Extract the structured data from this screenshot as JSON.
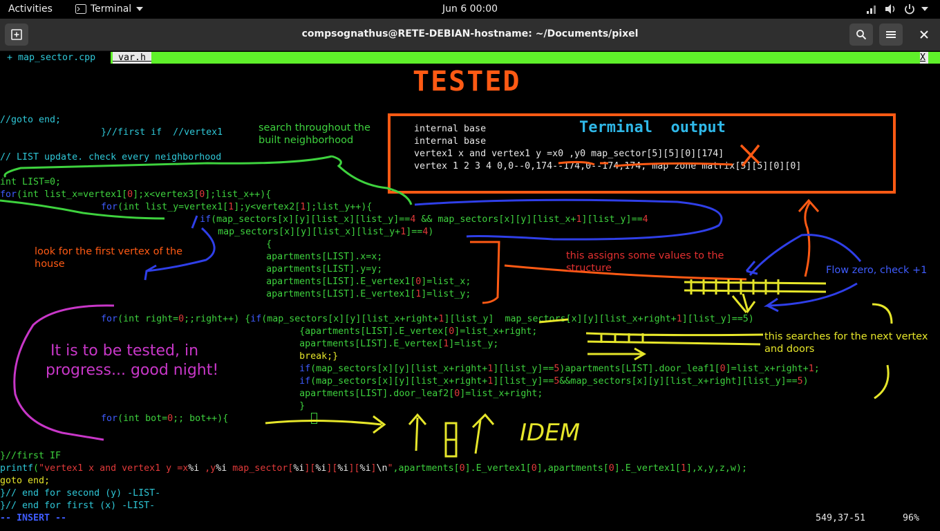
{
  "topbar": {
    "activities": "Activities",
    "app_menu": "Terminal",
    "clock": "Jun 6  00:00"
  },
  "window": {
    "title": "compsognathus@RETE-DEBIAN-hostname: ~/Documents/pixel"
  },
  "tabs": {
    "tab1": "+ map_sector.cpp ",
    "tab2": " var.h ",
    "close": "X"
  },
  "annotations": {
    "tested": "TESTED",
    "terminal_output_title": "Terminal  output",
    "search_note_1": "search throughout the",
    "search_note_2": "built neighborhood",
    "look_note_1": "look for the first vertex of the",
    "look_note_2": "house",
    "assign_note_1": "this assigns some values to the",
    "assign_note_2": "structure",
    "flow_note": "Flow zero, check +1",
    "next_note_1": "this searches for the next vertex",
    "next_note_2": "and doors",
    "progress_1": "It is  to be tested, in",
    "progress_2": "progress... good night!",
    "idem": "IDEM"
  },
  "terminal_output": {
    "line1": "internal base",
    "line2": "internal base",
    "line3": "vertex1 x and vertex1 y =x0 ,y0 map_sector[5][5][0][174]",
    "line4": "vertex 1 2 3 4 0,0--0,174--174,0--174,174, map zone matrix[5][5][0][0]"
  },
  "code": {
    "l1": "//goto end;",
    "l2": "        }//first if  //vertex1",
    "l3": "// LIST update. check every neighborhood",
    "l4": "int LIST=0;",
    "l5a": "for",
    "l5b": "(int list_x=vertex1[",
    "l5c": "0",
    "l5d": "];x<vertex3[",
    "l5e": "0",
    "l5f": "];list_x++){",
    "l6a": "        for",
    "l6b": "(int list_y=vertex1[",
    "l6c": "1",
    "l6d": "];y<vertex2[",
    "l6e": "1",
    "l6f": "];list_y++){",
    "l7a": "                if",
    "l7b": "(map_sectors[x][y][list_x][list_y]==",
    "l7c": "4",
    "l7d": " && map_sectors[x][y][list_x+",
    "l7e": "1",
    "l7f": "][list_y]==",
    "l7g": "4",
    "l8a": "                 map_sectors[x][y][list_x][list_y+",
    "l8b": "1",
    "l8c": "]==",
    "l8d": "4",
    "l8e": ")",
    "l9": "                    {",
    "l10": "                    apartments[LIST].x=x;",
    "l11": "                    apartments[LIST].y=y;",
    "l12a": "                    apartments[LIST].E_vertex1[",
    "l12b": "0",
    "l12c": "]=list_x;",
    "l13a": "                    apartments[LIST].E_vertex1[",
    "l13b": "1",
    "l13c": "]=list_y;",
    "l14a": "        for",
    "l14b": "(int right=",
    "l14c": "0",
    "l14d": ";;right++) {",
    "l14e": "if",
    "l14f": "(map_sectors[x][y][list_x+right+",
    "l14g": "1",
    "l14h": "][list_y]",
    "l14i": "  ",
    "l14j": "map_sectors[x][y][list_x+right+",
    "l14k": "1",
    "l14l": "][list_y]",
    "l14m": "==5)",
    "l15a": "                        {apartments[LIST].E_vertex[",
    "l15b": "0",
    "l15c": "]=list_x+right;",
    "l16a": "                        apartments[LIST].E_vertex[",
    "l16b": "1",
    "l16c": "]=list_y;",
    "l17": "                        break;}",
    "l18a": "                        if",
    "l18b": "(map_sectors[x][y][list_x+right+",
    "l18c": "1",
    "l18d": "][list_y]==",
    "l18e": "5",
    "l18f": ")apartments[LIST].door_leaf1[",
    "l18g": "0",
    "l18h": "]=list_x+right+",
    "l18i": "1",
    "l18j": ";",
    "l19a": "                        if",
    "l19b": "(map_sectors[x][y][list_x+right+",
    "l19c": "1",
    "l19d": "][list_y]==",
    "l19e": "5",
    "l19f": "&&map_sectors[x][y][list_x+right][list_y]==",
    "l19g": "5",
    "l19h": ")",
    "l20a": "                        apartments[LIST].door_leaf2[",
    "l20b": "0",
    "l20c": "]=list_x+right;",
    "l21": "                        }",
    "l22a": "        for",
    "l22b": "(int bot=",
    "l22c": "0",
    "l22d": ";; bot++){",
    "l23": "}//first IF",
    "l24a": "printf",
    "l24b": "(",
    "l24c": "\"vertex1 x and vertex1 y =x",
    "l24d": "%i",
    "l24e": " ,y",
    "l24f": "%i",
    "l24g": " map_sector[",
    "l24h": "%i",
    "l24i": "][",
    "l24j": "%i",
    "l24k": "][",
    "l24l": "%i",
    "l24m": "][",
    "l24n": "%i",
    "l24o": "]",
    "l24p": "\\n",
    "l24q": "\"",
    "l24r": ",apartments[",
    "l24s": "0",
    "l24t": "].E_vertex1[",
    "l24u": "0",
    "l24v": "],apartments[",
    "l24w": "0",
    "l24x": "].E_vertex1[",
    "l24y": "1",
    "l24z": "],x,y,z,w);",
    "l25": "goto end;",
    "l26": "}// end for second (y) -LIST-",
    "l27": "}// end for first (x) -LIST-"
  },
  "statusline": {
    "mode": "-- INSERT --",
    "position": "549,37-51",
    "percent": "96%"
  }
}
